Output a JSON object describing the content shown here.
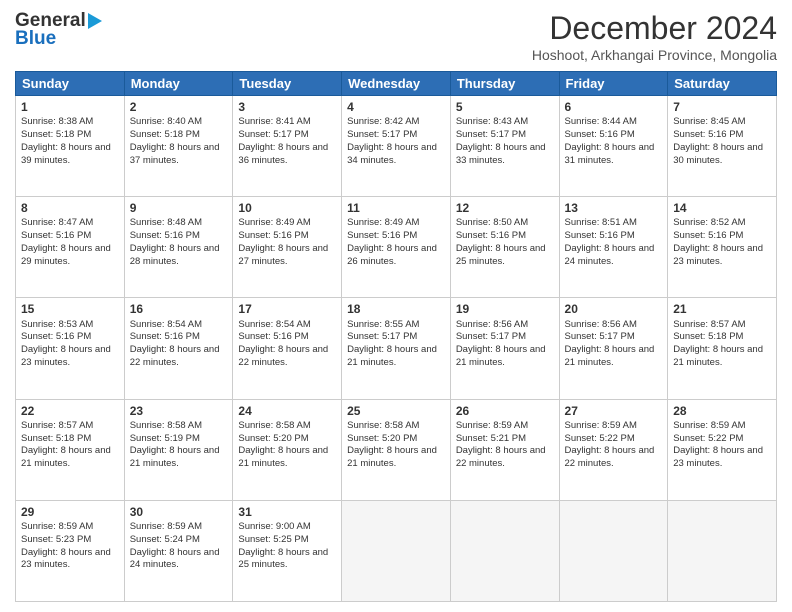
{
  "logo": {
    "general": "General",
    "blue": "Blue"
  },
  "header": {
    "month": "December 2024",
    "location": "Hoshoot, Arkhangai Province, Mongolia"
  },
  "days": [
    "Sunday",
    "Monday",
    "Tuesday",
    "Wednesday",
    "Thursday",
    "Friday",
    "Saturday"
  ],
  "weeks": [
    [
      {
        "day": "1",
        "sunrise": "8:38 AM",
        "sunset": "5:18 PM",
        "daylight": "8 hours and 39 minutes."
      },
      {
        "day": "2",
        "sunrise": "8:40 AM",
        "sunset": "5:18 PM",
        "daylight": "8 hours and 37 minutes."
      },
      {
        "day": "3",
        "sunrise": "8:41 AM",
        "sunset": "5:17 PM",
        "daylight": "8 hours and 36 minutes."
      },
      {
        "day": "4",
        "sunrise": "8:42 AM",
        "sunset": "5:17 PM",
        "daylight": "8 hours and 34 minutes."
      },
      {
        "day": "5",
        "sunrise": "8:43 AM",
        "sunset": "5:17 PM",
        "daylight": "8 hours and 33 minutes."
      },
      {
        "day": "6",
        "sunrise": "8:44 AM",
        "sunset": "5:16 PM",
        "daylight": "8 hours and 31 minutes."
      },
      {
        "day": "7",
        "sunrise": "8:45 AM",
        "sunset": "5:16 PM",
        "daylight": "8 hours and 30 minutes."
      }
    ],
    [
      {
        "day": "8",
        "sunrise": "8:47 AM",
        "sunset": "5:16 PM",
        "daylight": "8 hours and 29 minutes."
      },
      {
        "day": "9",
        "sunrise": "8:48 AM",
        "sunset": "5:16 PM",
        "daylight": "8 hours and 28 minutes."
      },
      {
        "day": "10",
        "sunrise": "8:49 AM",
        "sunset": "5:16 PM",
        "daylight": "8 hours and 27 minutes."
      },
      {
        "day": "11",
        "sunrise": "8:49 AM",
        "sunset": "5:16 PM",
        "daylight": "8 hours and 26 minutes."
      },
      {
        "day": "12",
        "sunrise": "8:50 AM",
        "sunset": "5:16 PM",
        "daylight": "8 hours and 25 minutes."
      },
      {
        "day": "13",
        "sunrise": "8:51 AM",
        "sunset": "5:16 PM",
        "daylight": "8 hours and 24 minutes."
      },
      {
        "day": "14",
        "sunrise": "8:52 AM",
        "sunset": "5:16 PM",
        "daylight": "8 hours and 23 minutes."
      }
    ],
    [
      {
        "day": "15",
        "sunrise": "8:53 AM",
        "sunset": "5:16 PM",
        "daylight": "8 hours and 23 minutes."
      },
      {
        "day": "16",
        "sunrise": "8:54 AM",
        "sunset": "5:16 PM",
        "daylight": "8 hours and 22 minutes."
      },
      {
        "day": "17",
        "sunrise": "8:54 AM",
        "sunset": "5:16 PM",
        "daylight": "8 hours and 22 minutes."
      },
      {
        "day": "18",
        "sunrise": "8:55 AM",
        "sunset": "5:17 PM",
        "daylight": "8 hours and 21 minutes."
      },
      {
        "day": "19",
        "sunrise": "8:56 AM",
        "sunset": "5:17 PM",
        "daylight": "8 hours and 21 minutes."
      },
      {
        "day": "20",
        "sunrise": "8:56 AM",
        "sunset": "5:17 PM",
        "daylight": "8 hours and 21 minutes."
      },
      {
        "day": "21",
        "sunrise": "8:57 AM",
        "sunset": "5:18 PM",
        "daylight": "8 hours and 21 minutes."
      }
    ],
    [
      {
        "day": "22",
        "sunrise": "8:57 AM",
        "sunset": "5:18 PM",
        "daylight": "8 hours and 21 minutes."
      },
      {
        "day": "23",
        "sunrise": "8:58 AM",
        "sunset": "5:19 PM",
        "daylight": "8 hours and 21 minutes."
      },
      {
        "day": "24",
        "sunrise": "8:58 AM",
        "sunset": "5:20 PM",
        "daylight": "8 hours and 21 minutes."
      },
      {
        "day": "25",
        "sunrise": "8:58 AM",
        "sunset": "5:20 PM",
        "daylight": "8 hours and 21 minutes."
      },
      {
        "day": "26",
        "sunrise": "8:59 AM",
        "sunset": "5:21 PM",
        "daylight": "8 hours and 22 minutes."
      },
      {
        "day": "27",
        "sunrise": "8:59 AM",
        "sunset": "5:22 PM",
        "daylight": "8 hours and 22 minutes."
      },
      {
        "day": "28",
        "sunrise": "8:59 AM",
        "sunset": "5:22 PM",
        "daylight": "8 hours and 23 minutes."
      }
    ],
    [
      {
        "day": "29",
        "sunrise": "8:59 AM",
        "sunset": "5:23 PM",
        "daylight": "8 hours and 23 minutes."
      },
      {
        "day": "30",
        "sunrise": "8:59 AM",
        "sunset": "5:24 PM",
        "daylight": "8 hours and 24 minutes."
      },
      {
        "day": "31",
        "sunrise": "9:00 AM",
        "sunset": "5:25 PM",
        "daylight": "8 hours and 25 minutes."
      },
      null,
      null,
      null,
      null
    ]
  ]
}
